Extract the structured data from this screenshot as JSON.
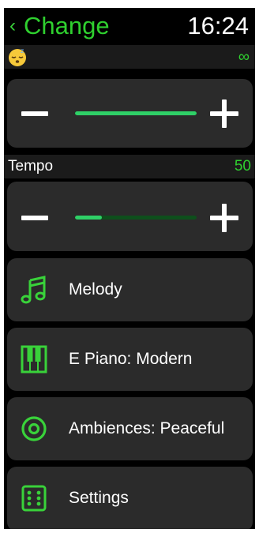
{
  "header": {
    "back_chevron": "‹",
    "title": "Change",
    "time": "16:24"
  },
  "sleep_row": {
    "icon": "sleeping-face-icon",
    "value": "∞"
  },
  "sleep_slider": {
    "level": 1.0
  },
  "tempo": {
    "label": "Tempo",
    "value": "50",
    "level": 0.22
  },
  "menu": [
    {
      "icon": "music-note-icon",
      "label": "Melody"
    },
    {
      "icon": "piano-keys-icon",
      "label": "E Piano: Modern"
    },
    {
      "icon": "target-circle-icon",
      "label": "Ambiences: Peaceful"
    },
    {
      "icon": "dice-icon",
      "label": "Settings"
    }
  ],
  "colors": {
    "accent": "#2fd02f",
    "slider": "#2fd067",
    "card": "#2b2b2b",
    "background": "#000000"
  }
}
